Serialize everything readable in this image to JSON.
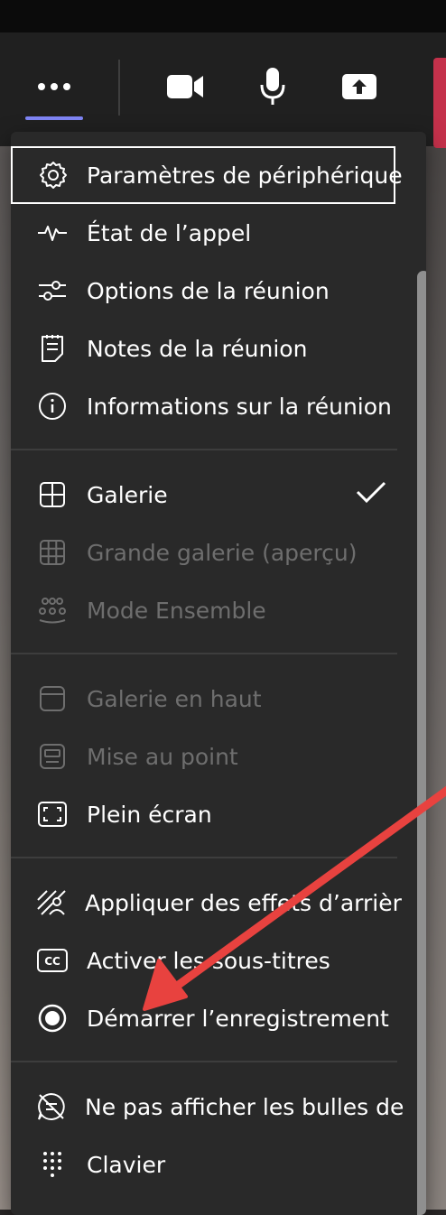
{
  "colors": {
    "accent": "#7f85f5",
    "leave": "#c4314b",
    "arrow": "#e8423f"
  },
  "toolbar": {
    "more": "more-horizontal-icon",
    "camera": "video-camera-icon",
    "mic": "microphone-icon",
    "share": "share-screen-icon"
  },
  "menu": {
    "items": [
      {
        "label": "Paramètres de périphérique",
        "icon": "gear-icon"
      },
      {
        "label": "État de l’appel",
        "icon": "pulse-icon"
      },
      {
        "label": "Options de la réunion",
        "icon": "sliders-icon"
      },
      {
        "label": "Notes de la réunion",
        "icon": "notes-icon"
      },
      {
        "label": "Informations sur la réunion",
        "icon": "info-icon"
      },
      {
        "label": "Galerie",
        "icon": "gallery-icon",
        "checked": true
      },
      {
        "label": "Grande galerie (aperçu)",
        "icon": "large-gallery-icon",
        "disabled": true
      },
      {
        "label": "Mode Ensemble",
        "icon": "together-mode-icon",
        "disabled": true
      },
      {
        "label": "Galerie en haut",
        "icon": "gallery-top-icon",
        "disabled": true
      },
      {
        "label": "Mise au point",
        "icon": "focus-icon",
        "disabled": true
      },
      {
        "label": "Plein écran",
        "icon": "fullscreen-icon"
      },
      {
        "label": "Appliquer des effets d’arrièr",
        "icon": "background-effects-icon"
      },
      {
        "label": "Activer les sous-titres",
        "icon": "captions-icon"
      },
      {
        "label": "Démarrer l’enregistrement",
        "icon": "record-icon"
      },
      {
        "label": "Ne pas afficher les bulles de",
        "icon": "chat-off-icon"
      },
      {
        "label": "Clavier",
        "icon": "dialpad-icon"
      }
    ]
  }
}
